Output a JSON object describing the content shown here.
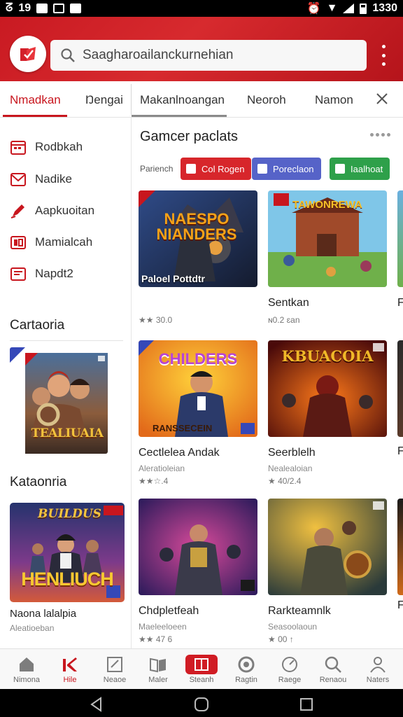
{
  "status_bar": {
    "left_number": "19",
    "time": "1330"
  },
  "header": {
    "search_placeholder": "Saagharoailanckurnehian",
    "colors": {
      "brand_red": "#c91a22"
    }
  },
  "tabs": {
    "left_active": "Nmadkan",
    "left_second": "Ŋengai",
    "items": [
      "Makanlnoangan",
      "Neoroh",
      "Namon"
    ]
  },
  "sidebar": {
    "items": [
      {
        "label": "Rodbkah",
        "icon": "calendar-icon"
      },
      {
        "label": "Nadike",
        "icon": "mail-icon"
      },
      {
        "label": "Aapkuoitan",
        "icon": "pen-icon"
      },
      {
        "label": "Mamialcah",
        "icon": "photo-icon"
      },
      {
        "label": "Napdt2",
        "icon": "document-icon"
      }
    ],
    "heading_1": "Cartaoria",
    "promo_1_text": "TEALIUAIA",
    "heading_2": "Kataonria",
    "promo_2_top": "BUILDUS",
    "promo_2_text": "HENLIUCH",
    "game_title": "Naona lalalpia",
    "game_sub": "Aleatioeban"
  },
  "main": {
    "section_title": "Gamcer paclats",
    "filter_label": "Pariench",
    "chips": [
      {
        "label": "Col Rogen",
        "color": "#d7262b"
      },
      {
        "label": "Poreclaon",
        "color": "#5663c8"
      },
      {
        "label": "Iaalhoat",
        "color": "#2ea04a"
      }
    ],
    "cards": [
      {
        "title": "",
        "banner_text": "NAESPO NIANDERS",
        "caption": "Paloel Pottdtr",
        "sub": "",
        "rating": "★★ 30.0"
      },
      {
        "title": "Sentkan",
        "banner_text": "TAWONREWA",
        "caption": "",
        "sub": "",
        "rating": "ɴ0.2 ɛan"
      },
      {
        "title": "Cectlelea Andak",
        "banner_text": "CHILDERS",
        "caption": "RANSSECEIN",
        "sub": "Aleratioleian",
        "rating": "★★☆.4"
      },
      {
        "title": "Seerblelh",
        "banner_text": "KBUACOIA",
        "caption": "",
        "sub": "Nealealoian",
        "rating": "★ 40/2.4"
      },
      {
        "title": "Chdpletfeah",
        "banner_text": "",
        "caption": "",
        "sub": "Maeleeloeen",
        "rating": "★★ 47 6"
      },
      {
        "title": "Rarkteamnlk",
        "banner_text": "",
        "caption": "",
        "sub": "Seasoolaoun",
        "rating": "★ 00 ↑"
      }
    ],
    "peeks": [
      "F",
      "F",
      "F"
    ]
  },
  "bottom_nav": {
    "items": [
      {
        "label": "Nimona",
        "icon": "home-icon"
      },
      {
        "label": "Hile",
        "icon": "chart-icon"
      },
      {
        "label": "Neaoe",
        "icon": "edit-box-icon"
      },
      {
        "label": "Maler",
        "icon": "books-icon"
      },
      {
        "label": "Steanh",
        "icon": "book-icon"
      },
      {
        "label": "Ragtin",
        "icon": "settings-icon"
      },
      {
        "label": "Raege",
        "icon": "gauge-icon"
      },
      {
        "label": "Renaou",
        "icon": "search-icon"
      },
      {
        "label": "Naters",
        "icon": "profile-icon"
      }
    ]
  }
}
